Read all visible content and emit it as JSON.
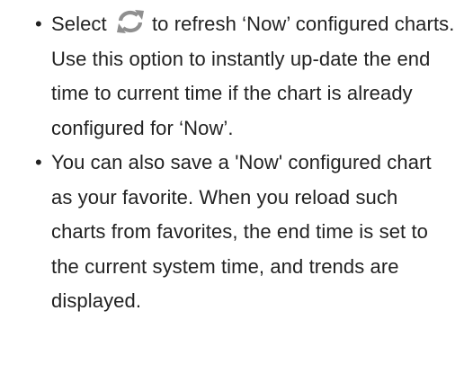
{
  "bullets": [
    {
      "marker": "•",
      "before_icon": "Select",
      "icon": "refresh-icon",
      "after_icon": "to refresh ‘Now’ configured charts. Use this option to instantly up-date the end time to current time if the chart is already configured for ‘Now’."
    },
    {
      "marker": "•",
      "text": "You can also save a 'Now' configured chart as your favorite. When you reload such charts from favorites, the end time is set to the current system time, and trends are displayed."
    }
  ],
  "colors": {
    "text": "#222222",
    "icon_fill": "#8f8f8f"
  }
}
